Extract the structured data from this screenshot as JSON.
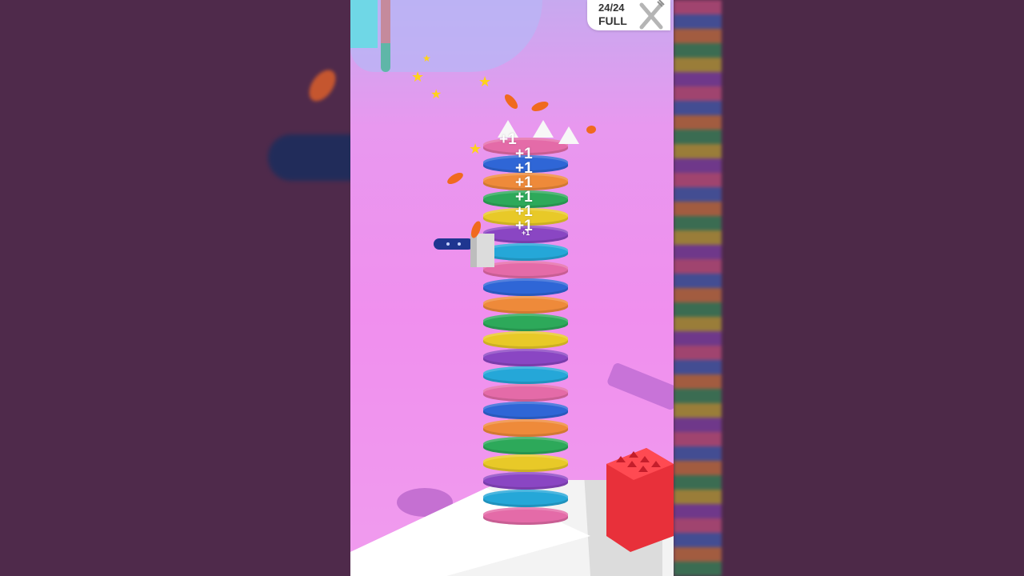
{
  "hud": {
    "count": "24/24",
    "status": "FULL",
    "icon": "fork-knife-icon"
  },
  "tower": {
    "stripe_colors": [
      "#e46ba8",
      "#2f66d6",
      "#ee8a3a",
      "#2da95a",
      "#e8c928",
      "#8a46c3",
      "#25a7d8"
    ],
    "score_popups": [
      "+1",
      "+1",
      "+1",
      "+1",
      "+1",
      "+1",
      "+1"
    ],
    "small_popups": [
      "+1"
    ]
  },
  "colors": {
    "background_side": "#4f2a4b",
    "floor": "#f09cee",
    "platform": "#f2f2f2",
    "knife_handle": "#1f3690"
  }
}
